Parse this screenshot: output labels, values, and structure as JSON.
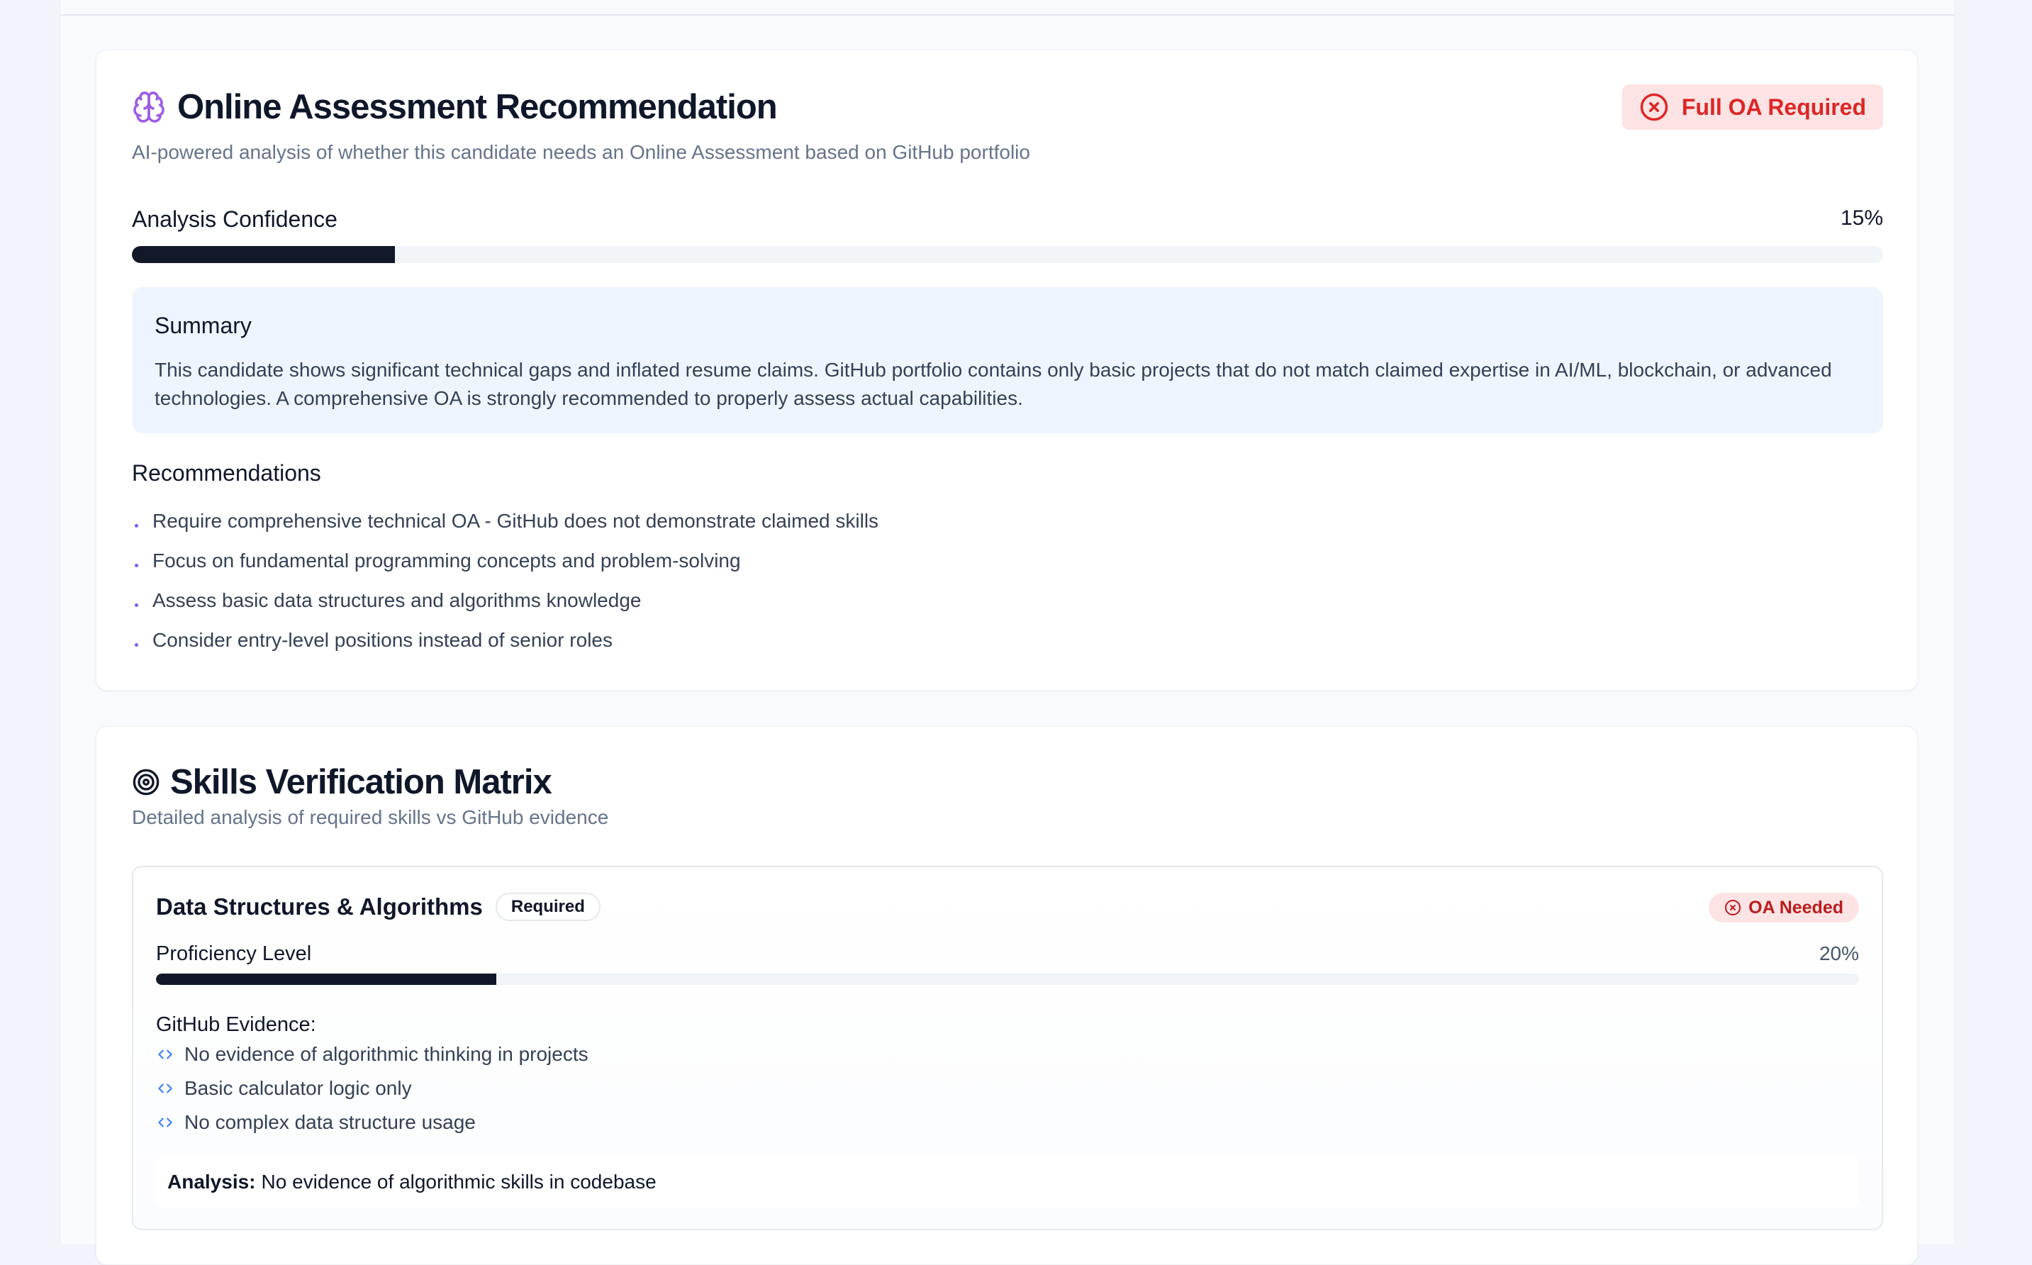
{
  "oa": {
    "title": "Online Assessment Recommendation",
    "subtitle": "AI-powered analysis of whether this candidate needs an Online Assessment based on GitHub portfolio",
    "status_badge": "Full OA Required",
    "confidence_label": "Analysis Confidence",
    "confidence_value": "15%",
    "confidence_fraction": 0.15,
    "summary_title": "Summary",
    "summary_text": "This candidate shows significant technical gaps and inflated resume claims. GitHub portfolio contains only basic projects that do not match claimed expertise in AI/ML, blockchain, or advanced technologies. A comprehensive OA is strongly recommended to properly assess actual capabilities.",
    "recommendations_title": "Recommendations",
    "recommendations": [
      "Require comprehensive technical OA - GitHub does not demonstrate claimed skills",
      "Focus on fundamental programming concepts and problem-solving",
      "Assess basic data structures and algorithms knowledge",
      "Consider entry-level positions instead of senior roles"
    ]
  },
  "skills": {
    "title": "Skills Verification Matrix",
    "subtitle": "Detailed analysis of required skills vs GitHub evidence",
    "items": [
      {
        "name": "Data Structures & Algorithms",
        "tag": "Required",
        "status": "OA Needed",
        "proficiency_label": "Proficiency Level",
        "proficiency_value": "20%",
        "proficiency_fraction": 0.2,
        "evidence_title": "GitHub Evidence:",
        "evidence": [
          "No evidence of algorithmic thinking in projects",
          "Basic calculator logic only",
          "No complex data structure usage"
        ],
        "analysis_label": "Analysis:",
        "analysis_text": "No evidence of algorithmic skills in codebase"
      }
    ]
  },
  "colors": {
    "accent_purple": "#7c5cf0",
    "danger": "#dc2626",
    "danger_bg": "#fde3e3",
    "bar_fill": "#111827",
    "summary_bg": "#eff5fe",
    "code_icon": "#3b82f6"
  },
  "icons": {
    "oa_title": "brain-icon",
    "status": "x-circle-icon",
    "skills_title": "target-icon",
    "evidence": "code-icon"
  }
}
